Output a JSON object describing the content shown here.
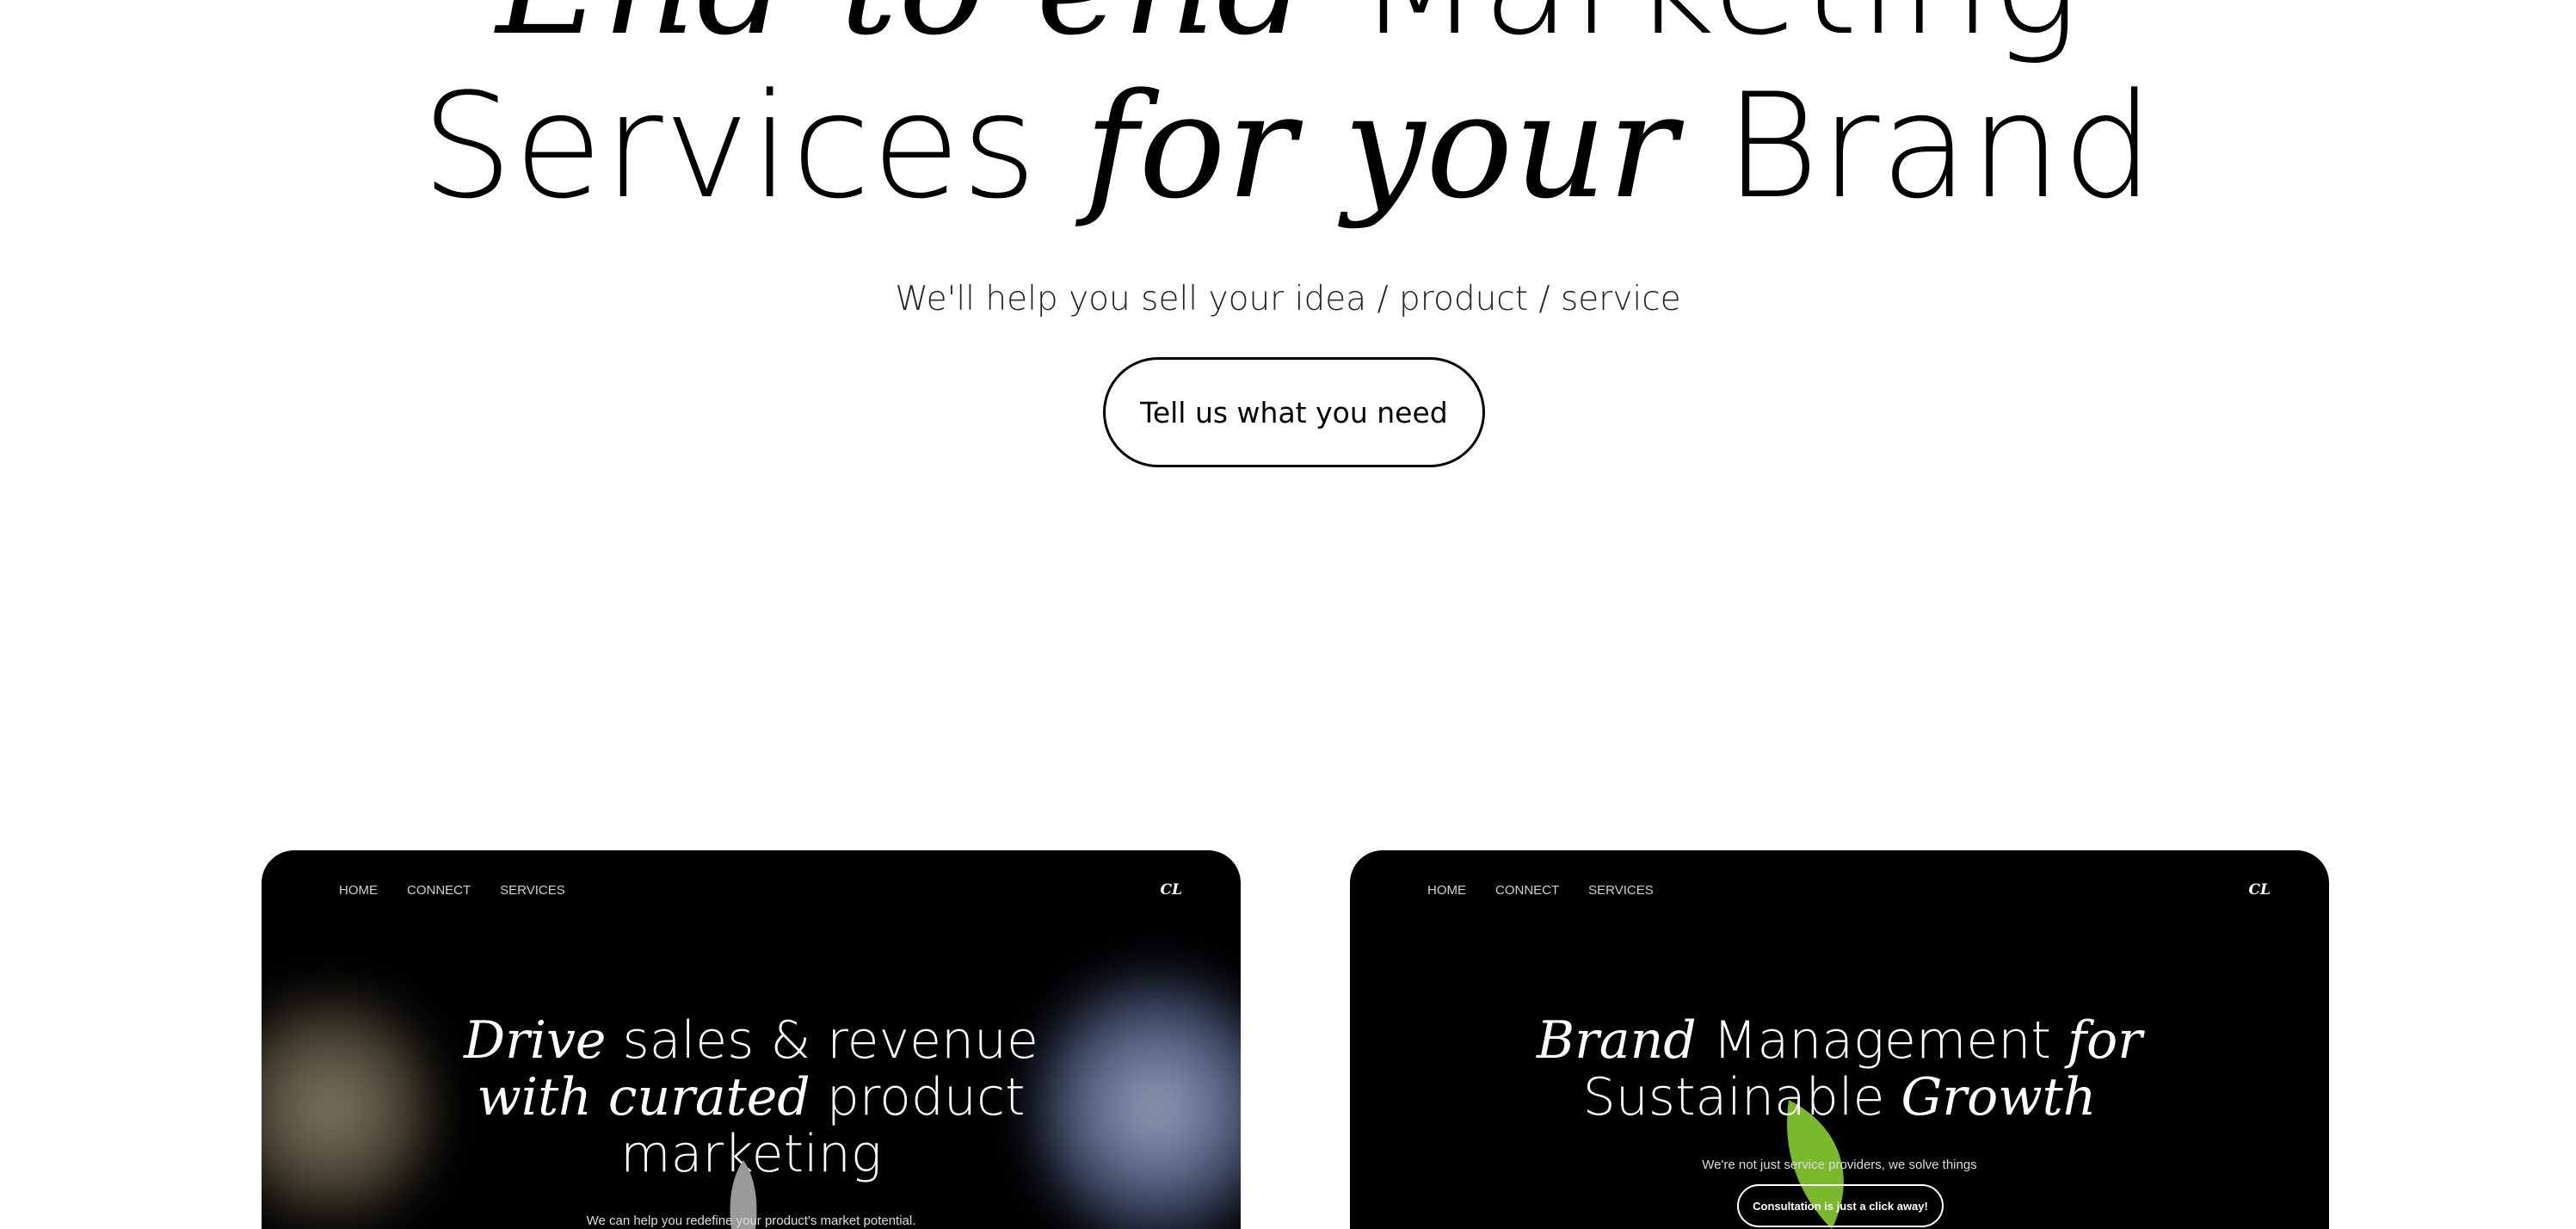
{
  "hero": {
    "line1_italic": "End-to-end",
    "line1_regular": " Marketing",
    "line2_regular_a": "Services ",
    "line2_italic": "for your",
    "line2_regular_b": " Brand",
    "subtitle": "We'll help you sell your idea / product / service",
    "cta_label": "Tell us what you need"
  },
  "cards": [
    {
      "nav": [
        "HOME",
        "CONNECT",
        "SERVICES"
      ],
      "logo": "CL",
      "title_italic_1": "Drive",
      "title_regular_1": " sales & revenue",
      "title_italic_2": "with curated",
      "title_regular_2": " product",
      "title_regular_3": "marketing",
      "subtitle": "We can help you redefine your product's market potential."
    },
    {
      "nav": [
        "HOME",
        "CONNECT",
        "SERVICES"
      ],
      "logo": "CL",
      "title_italic_1": "Brand",
      "title_regular_1": " Management ",
      "title_italic_2": "for",
      "title_regular_2": "Sustainable ",
      "title_italic_3": "Growth",
      "subtitle": "We're not just service providers, we solve things",
      "button_label": "Consultation is just a click away!"
    }
  ],
  "colors": {
    "page_bg": "#ffffff",
    "card_bg": "#000000",
    "leaf_accent": "#7ab82e"
  }
}
